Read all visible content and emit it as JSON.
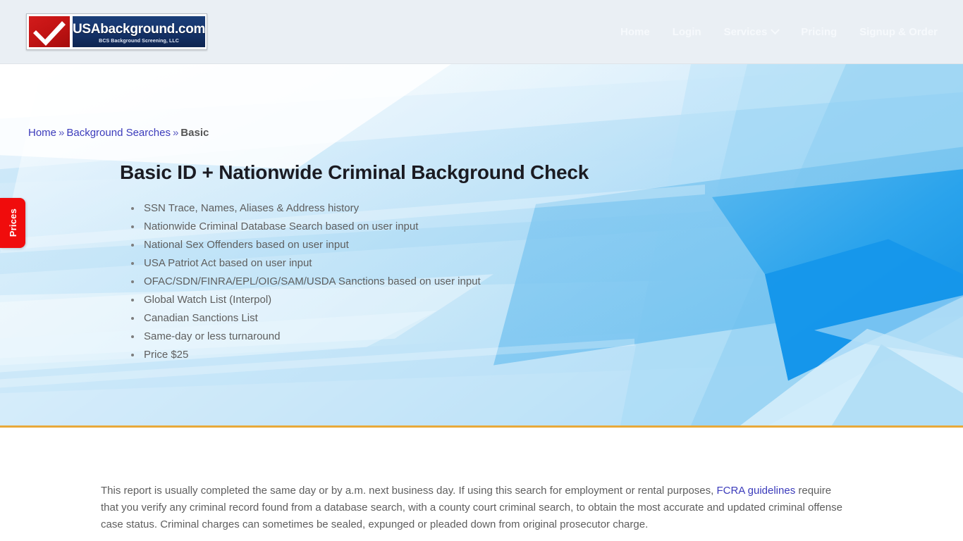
{
  "header": {
    "logo": {
      "title": "USAbackground.com",
      "subtitle": "BCS Background Screening, LLC"
    },
    "nav": [
      {
        "label": "Home",
        "has_caret": false
      },
      {
        "label": "Login",
        "has_caret": false
      },
      {
        "label": "Services",
        "has_caret": true
      },
      {
        "label": "Pricing",
        "has_caret": false
      },
      {
        "label": "Signup & Order",
        "has_caret": false
      }
    ]
  },
  "breadcrumb": {
    "home": "Home",
    "sep1": "»",
    "parent": "Background Searches",
    "sep2": "»",
    "current": "Basic"
  },
  "hero": {
    "title": "Basic ID + Nationwide Criminal Background Check",
    "features": [
      "SSN Trace, Names, Aliases & Address history",
      "Nationwide Criminal Database Search based on user input",
      "National Sex Offenders based on user input",
      "USA Patriot Act based on user input",
      "OFAC/SDN/FINRA/EPL/OIG/SAM/USDA Sanctions based on user input",
      "Global Watch List (Interpol)",
      "Canadian Sanctions List",
      "Same-day or less turnaround",
      "Price $25"
    ]
  },
  "side_tab": {
    "label": "Prices"
  },
  "content": {
    "paragraph_part1": "This report is usually completed the same day or by a.m. next business day. If using this search for employment or rental purposes, ",
    "link_label": "FCRA guidelines",
    "paragraph_part2": " require that you verify any criminal record found from a database search, with a county court criminal search, to obtain the most accurate and updated criminal offense case status. Criminal charges can sometimes be sealed, expunged or pleaded down from original prosecutor charge."
  },
  "colors": {
    "header_bg": "#eaeff4",
    "nav_text": "#f6f9fc",
    "logo_red": "#c41414",
    "logo_blue": "#15336a",
    "link_blue": "#3b3bbb",
    "body_text": "#5e5e5e",
    "title_text": "#1b1b22",
    "hero_accent_blue": "#1596ea",
    "hero_border_orange": "#e8a93a",
    "prices_tab_red": "#f00c0c"
  }
}
